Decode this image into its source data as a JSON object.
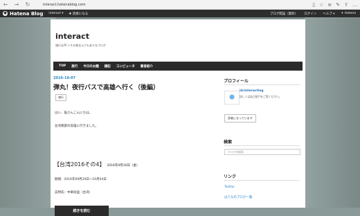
{
  "browser": {
    "url": "interact.hatenablog.com"
  },
  "hatena_bar": {
    "logo": "Hatena Blog",
    "items": [
      "interact ▾",
      "✚ 読者になる"
    ],
    "right": [
      "ブログ開設（無料）",
      "ログイン",
      "ヘルプ ▾",
      "✦ Hatena"
    ]
  },
  "blog": {
    "title": "interact",
    "description": "旅行＆PC＋その他なんでもありなブログ",
    "nav": [
      "TOP",
      "旅行",
      "今日のお題",
      "雑記",
      "コンピュータ",
      "著者紹介"
    ]
  },
  "post": {
    "date": "2016-10-07",
    "title": "弾丸！夜行バスで高雄へ行く（後編）",
    "category": "旅行",
    "para1": "はい、猫さんこんにちは。",
    "para2": "台湾南部の高雄に行きました。",
    "section_title": "【台湾2016その4】",
    "section_date": "2016年9月30日（金）",
    "period": "期間：2016年09月29日〜10月04日",
    "visit": "訪問先：中華民国（台湾）",
    "read_more": "続きを読む"
  },
  "sidebar": {
    "profile_heading": "プロフィール",
    "profile_id": "id:interacting",
    "profile_desc": "詳しくは自己紹介をご覧ください。",
    "reader_button": "読者になっています",
    "search_heading": "検索",
    "search_placeholder": "ブログ内検索",
    "links_heading": "リンク",
    "links": [
      "Twitter",
      "はてなのブログ一覧"
    ]
  }
}
